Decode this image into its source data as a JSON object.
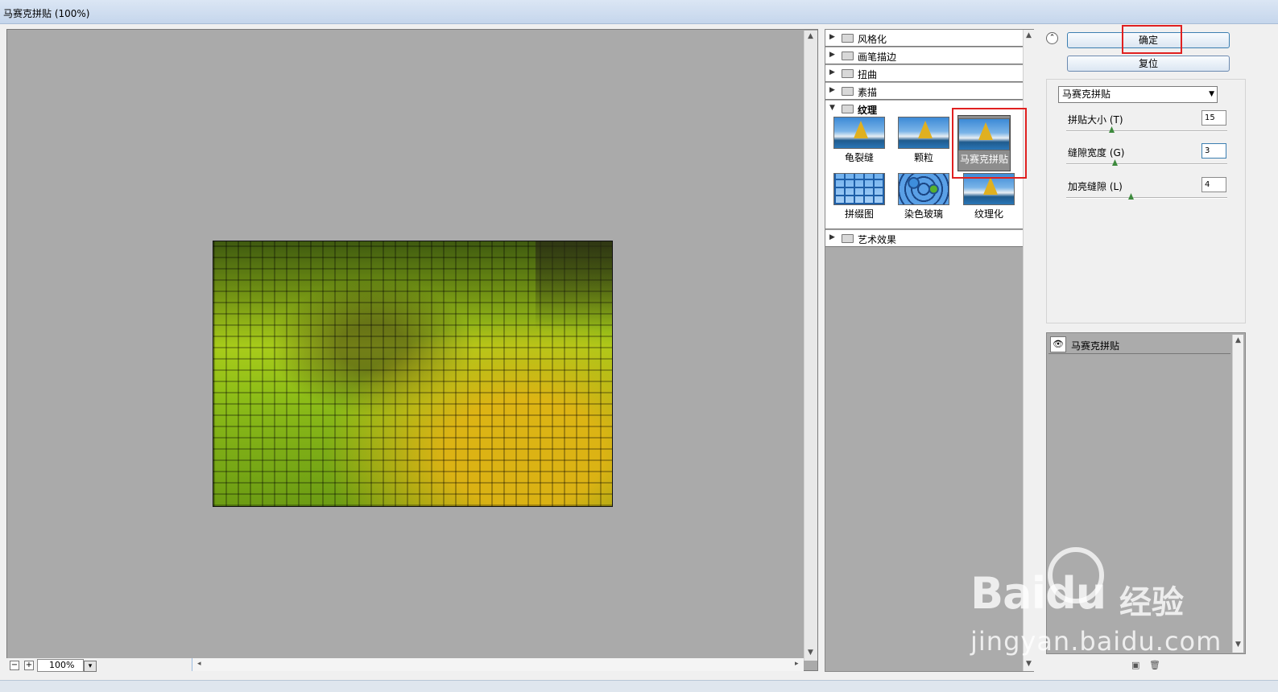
{
  "window": {
    "title": "马赛克拼贴 (100%)"
  },
  "preview": {
    "zoom": "100%",
    "zoom_out": "−",
    "zoom_in": "+",
    "dropdown_arrow": "▾"
  },
  "gallery": {
    "categories": [
      {
        "label": "风格化",
        "expanded": false
      },
      {
        "label": "画笔描边",
        "expanded": false
      },
      {
        "label": "扭曲",
        "expanded": false
      },
      {
        "label": "素描",
        "expanded": false
      },
      {
        "label": "纹理",
        "expanded": true
      },
      {
        "label": "艺术效果",
        "expanded": false
      }
    ],
    "texture_filters": [
      {
        "label": "龟裂缝",
        "icon": "sailboat-thumbnail"
      },
      {
        "label": "颗粒",
        "icon": "sailboat-thumbnail"
      },
      {
        "label": "马赛克拼贴",
        "icon": "sailboat-thumbnail",
        "selected": true
      },
      {
        "label": "拼缀图",
        "icon": "patchwork-thumbnail"
      },
      {
        "label": "染色玻璃",
        "icon": "stained-glass-thumbnail"
      },
      {
        "label": "纹理化",
        "icon": "sailboat-thumbnail"
      }
    ]
  },
  "buttons": {
    "ok": "确定",
    "reset": "复位",
    "collapse": "⌃"
  },
  "settings": {
    "filter_select": "马赛克拼贴",
    "params": [
      {
        "label": "拼贴大小 (T)",
        "value": "15",
        "level": 0.28
      },
      {
        "label": "缝隙宽度 (G)",
        "value": "3",
        "level": 0.3
      },
      {
        "label": "加亮缝隙 (L)",
        "value": "4",
        "level": 0.4
      }
    ]
  },
  "layers": {
    "items": [
      {
        "name": "马赛克拼贴",
        "visible": true
      }
    ]
  },
  "watermark": {
    "logo": "Baidu",
    "brand": "经验",
    "url": "jingyan.baidu.com"
  },
  "colors": {
    "highlight": "#e02020",
    "canvas_bg": "#aaaaaa",
    "button_border": "#3c7fb1"
  }
}
